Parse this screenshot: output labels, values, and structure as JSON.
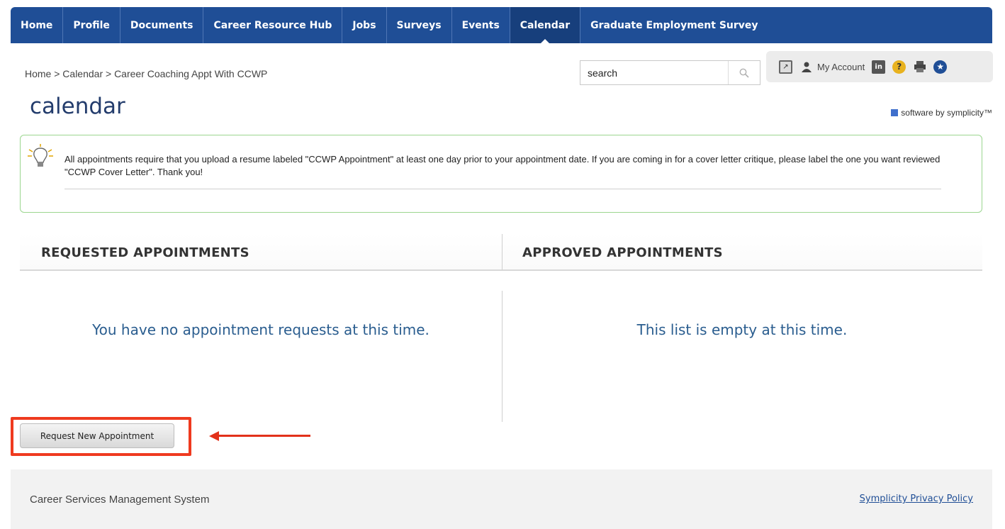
{
  "nav": {
    "items": [
      {
        "label": "Home"
      },
      {
        "label": "Profile"
      },
      {
        "label": "Documents"
      },
      {
        "label": "Career Resource Hub"
      },
      {
        "label": "Jobs"
      },
      {
        "label": "Surveys"
      },
      {
        "label": "Events"
      },
      {
        "label": "Calendar",
        "active": true
      },
      {
        "label": "Graduate Employment Survey"
      }
    ],
    "color": "#1f4e96"
  },
  "breadcrumb": "Home > Calendar > Career Coaching Appt With CCWP",
  "search": {
    "value": "search",
    "icon": "search-icon"
  },
  "account": {
    "my_account_label": "My Account"
  },
  "page_title": "calendar",
  "branding": "software by symplicity™",
  "notice": {
    "text": "All appointments require that you upload a resume labeled \"CCWP Appointment\" at least one day prior to your appointment date. If you are coming in for a cover letter critique, please label the one you want reviewed \"CCWP Cover Letter\". Thank you!",
    "icon": "lightbulb-icon",
    "border_color": "#9bd68f"
  },
  "requested": {
    "heading": "REQUESTED APPOINTMENTS",
    "empty_message": "You have no appointment requests at this time."
  },
  "approved": {
    "heading": "APPROVED APPOINTMENTS",
    "empty_message": "This list is empty at this time."
  },
  "request_button": {
    "label": "Request New Appointment"
  },
  "annotation_color": "#ef3a1f",
  "footer": {
    "left": "Career Services Management System",
    "privacy_link": "Symplicity Privacy Policy"
  }
}
